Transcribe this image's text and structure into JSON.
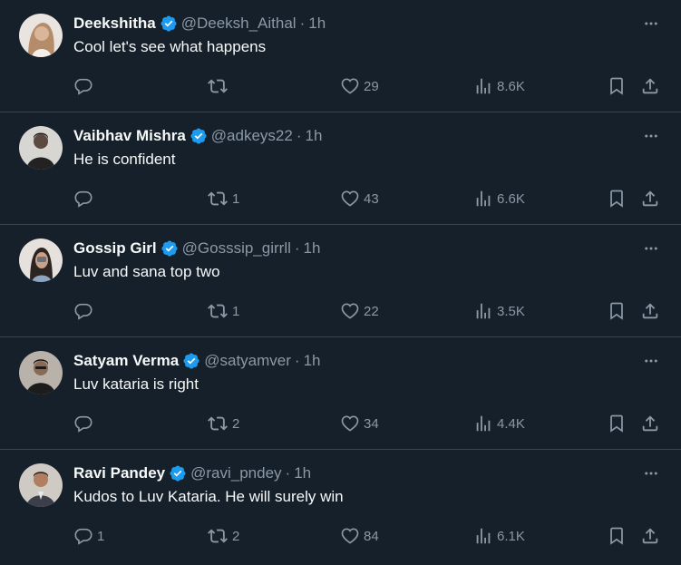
{
  "tweets": [
    {
      "name": "Deekshitha",
      "handle": "@Deeksh_Aithal",
      "time": "1h",
      "text": "Cool let's see what happens",
      "replies": "",
      "retweets": "",
      "likes": "29",
      "views": "8.6K"
    },
    {
      "name": "Vaibhav Mishra",
      "handle": "@adkeys22",
      "time": "1h",
      "text": "He is confident",
      "replies": "",
      "retweets": "1",
      "likes": "43",
      "views": "6.6K"
    },
    {
      "name": "Gossip Girl",
      "handle": "@Gosssip_girrll",
      "time": "1h",
      "text": "Luv and sana top two",
      "replies": "",
      "retweets": "1",
      "likes": "22",
      "views": "3.5K"
    },
    {
      "name": "Satyam Verma",
      "handle": "@satyamver",
      "time": "1h",
      "text": "Luv kataria is right",
      "replies": "",
      "retweets": "2",
      "likes": "34",
      "views": "4.4K"
    },
    {
      "name": "Ravi Pandey",
      "handle": "@ravi_pndey",
      "time": "1h",
      "text": "Kudos to Luv Kataria. He will surely win",
      "replies": "1",
      "retweets": "2",
      "likes": "84",
      "views": "6.1K"
    }
  ],
  "separator": "·",
  "colors": {
    "background": "#15202b",
    "text": "#f7f9f9",
    "secondary": "#8b98a5",
    "verified": "#1d9bf0",
    "divider": "#38444d"
  },
  "icons": [
    "verified-badge-icon",
    "more-icon",
    "reply-icon",
    "retweet-icon",
    "like-icon",
    "views-icon",
    "bookmark-icon",
    "share-icon"
  ]
}
